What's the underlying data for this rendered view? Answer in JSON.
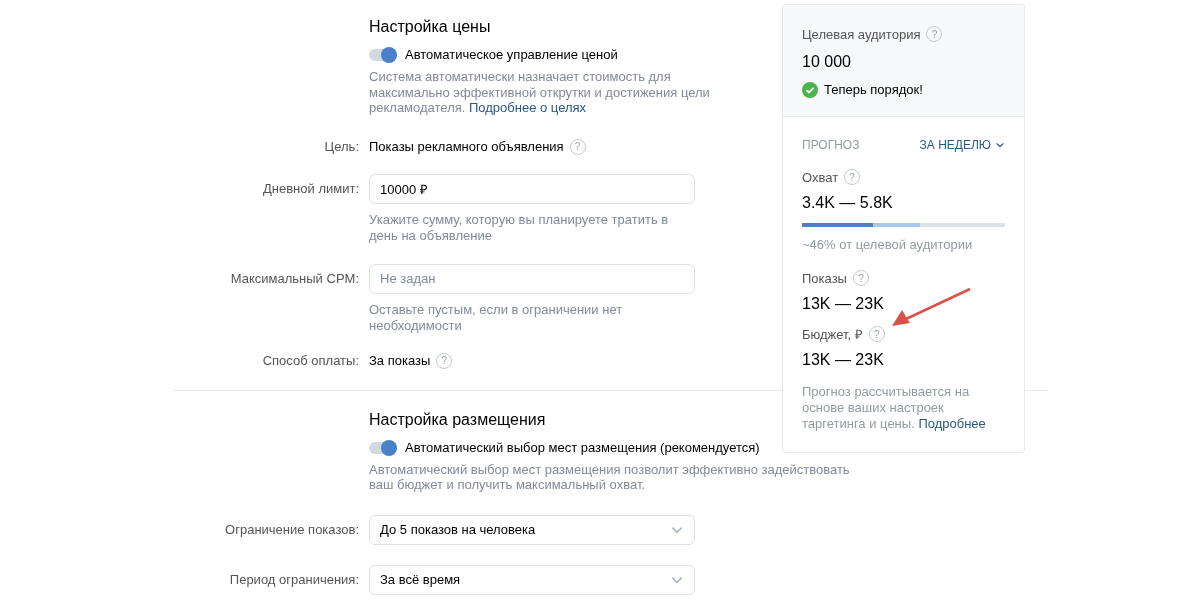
{
  "price_section": {
    "title": "Настройка цены",
    "toggle": {
      "label": "Автоматическое управление ценой",
      "on": true
    },
    "description": "Система автоматически назначает стоимость для максимально эффективной открутки и достижения цели рекламодателя.",
    "description_link": "Подробнее о целях",
    "fields": [
      {
        "kind": "text",
        "label": "Цель:",
        "value": "Показы рекламного объявления",
        "help": "?"
      },
      {
        "kind": "input",
        "label": "Дневной лимит:",
        "value": "10000 ₽",
        "hint": "Укажите сумму, которую вы планируете тратить в день на объявление"
      },
      {
        "kind": "input",
        "label": "Максимальный CPM:",
        "placeholder": "Не задан",
        "hint": "Оставьте пустым, если в ограничении нет необходимости"
      },
      {
        "kind": "text",
        "label": "Способ оплаты:",
        "value": "За показы",
        "help": "?"
      }
    ]
  },
  "placement_section": {
    "title": "Настройка размещения",
    "toggle": {
      "label": "Автоматический выбор мест размещения (рекомендуется)",
      "on": true
    },
    "description": "Автоматический выбор мест размещения позволит эффективно задействовать ваш бюджет и получить максимальный охват.",
    "fields": [
      {
        "kind": "select",
        "label": "Ограничение показов:",
        "value": "До 5 показов на человека"
      },
      {
        "kind": "select",
        "label": "Период ограничения:",
        "value": "За всё время"
      }
    ]
  },
  "forecast_panel": {
    "audience_label": "Целевая аудитория",
    "audience_help": "?",
    "audience_value": "10 000",
    "status": "Теперь порядок!",
    "forecast_label": "ПРОГНОЗ",
    "period": "ЗА НЕДЕЛЮ",
    "metrics": [
      {
        "label": "Охват",
        "help": "?",
        "value": "3.4K — 5.8K",
        "bar": [
          {
            "level": 0.35,
            "color": "#4a80c8"
          },
          {
            "level": 0.58,
            "color": "#a9c9ec"
          }
        ],
        "note": "~46% от целевой аудитории"
      },
      {
        "label": "Показы",
        "help": "?",
        "value": "13K — 23K"
      },
      {
        "label": "Бюджет, ₽",
        "help": "?",
        "value": "13K — 23K"
      }
    ],
    "footer": "Прогноз рассчитывается на основе ваших настроек таргетинга и цены.",
    "footer_link": "Подробнее"
  }
}
